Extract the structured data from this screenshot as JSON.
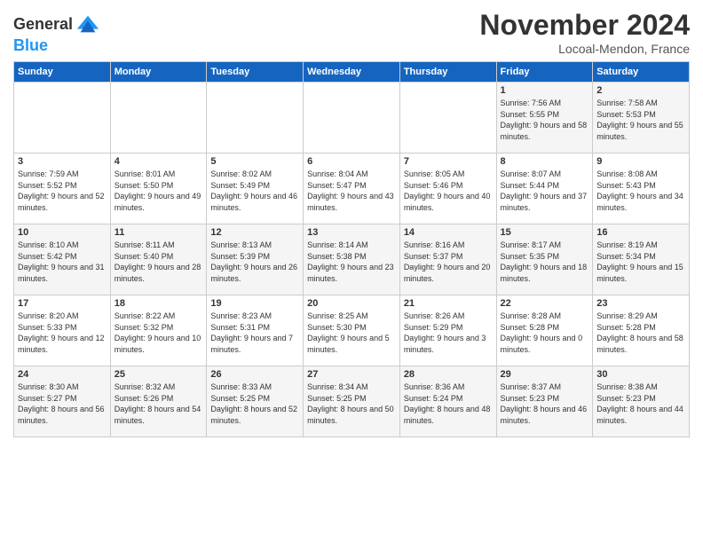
{
  "header": {
    "logo_line1": "General",
    "logo_line2": "Blue",
    "month_title": "November 2024",
    "location": "Locoal-Mendon, France"
  },
  "days_of_week": [
    "Sunday",
    "Monday",
    "Tuesday",
    "Wednesday",
    "Thursday",
    "Friday",
    "Saturday"
  ],
  "weeks": [
    [
      {
        "day": "",
        "info": ""
      },
      {
        "day": "",
        "info": ""
      },
      {
        "day": "",
        "info": ""
      },
      {
        "day": "",
        "info": ""
      },
      {
        "day": "",
        "info": ""
      },
      {
        "day": "1",
        "info": "Sunrise: 7:56 AM\nSunset: 5:55 PM\nDaylight: 9 hours and 58 minutes."
      },
      {
        "day": "2",
        "info": "Sunrise: 7:58 AM\nSunset: 5:53 PM\nDaylight: 9 hours and 55 minutes."
      }
    ],
    [
      {
        "day": "3",
        "info": "Sunrise: 7:59 AM\nSunset: 5:52 PM\nDaylight: 9 hours and 52 minutes."
      },
      {
        "day": "4",
        "info": "Sunrise: 8:01 AM\nSunset: 5:50 PM\nDaylight: 9 hours and 49 minutes."
      },
      {
        "day": "5",
        "info": "Sunrise: 8:02 AM\nSunset: 5:49 PM\nDaylight: 9 hours and 46 minutes."
      },
      {
        "day": "6",
        "info": "Sunrise: 8:04 AM\nSunset: 5:47 PM\nDaylight: 9 hours and 43 minutes."
      },
      {
        "day": "7",
        "info": "Sunrise: 8:05 AM\nSunset: 5:46 PM\nDaylight: 9 hours and 40 minutes."
      },
      {
        "day": "8",
        "info": "Sunrise: 8:07 AM\nSunset: 5:44 PM\nDaylight: 9 hours and 37 minutes."
      },
      {
        "day": "9",
        "info": "Sunrise: 8:08 AM\nSunset: 5:43 PM\nDaylight: 9 hours and 34 minutes."
      }
    ],
    [
      {
        "day": "10",
        "info": "Sunrise: 8:10 AM\nSunset: 5:42 PM\nDaylight: 9 hours and 31 minutes."
      },
      {
        "day": "11",
        "info": "Sunrise: 8:11 AM\nSunset: 5:40 PM\nDaylight: 9 hours and 28 minutes."
      },
      {
        "day": "12",
        "info": "Sunrise: 8:13 AM\nSunset: 5:39 PM\nDaylight: 9 hours and 26 minutes."
      },
      {
        "day": "13",
        "info": "Sunrise: 8:14 AM\nSunset: 5:38 PM\nDaylight: 9 hours and 23 minutes."
      },
      {
        "day": "14",
        "info": "Sunrise: 8:16 AM\nSunset: 5:37 PM\nDaylight: 9 hours and 20 minutes."
      },
      {
        "day": "15",
        "info": "Sunrise: 8:17 AM\nSunset: 5:35 PM\nDaylight: 9 hours and 18 minutes."
      },
      {
        "day": "16",
        "info": "Sunrise: 8:19 AM\nSunset: 5:34 PM\nDaylight: 9 hours and 15 minutes."
      }
    ],
    [
      {
        "day": "17",
        "info": "Sunrise: 8:20 AM\nSunset: 5:33 PM\nDaylight: 9 hours and 12 minutes."
      },
      {
        "day": "18",
        "info": "Sunrise: 8:22 AM\nSunset: 5:32 PM\nDaylight: 9 hours and 10 minutes."
      },
      {
        "day": "19",
        "info": "Sunrise: 8:23 AM\nSunset: 5:31 PM\nDaylight: 9 hours and 7 minutes."
      },
      {
        "day": "20",
        "info": "Sunrise: 8:25 AM\nSunset: 5:30 PM\nDaylight: 9 hours and 5 minutes."
      },
      {
        "day": "21",
        "info": "Sunrise: 8:26 AM\nSunset: 5:29 PM\nDaylight: 9 hours and 3 minutes."
      },
      {
        "day": "22",
        "info": "Sunrise: 8:28 AM\nSunset: 5:28 PM\nDaylight: 9 hours and 0 minutes."
      },
      {
        "day": "23",
        "info": "Sunrise: 8:29 AM\nSunset: 5:28 PM\nDaylight: 8 hours and 58 minutes."
      }
    ],
    [
      {
        "day": "24",
        "info": "Sunrise: 8:30 AM\nSunset: 5:27 PM\nDaylight: 8 hours and 56 minutes."
      },
      {
        "day": "25",
        "info": "Sunrise: 8:32 AM\nSunset: 5:26 PM\nDaylight: 8 hours and 54 minutes."
      },
      {
        "day": "26",
        "info": "Sunrise: 8:33 AM\nSunset: 5:25 PM\nDaylight: 8 hours and 52 minutes."
      },
      {
        "day": "27",
        "info": "Sunrise: 8:34 AM\nSunset: 5:25 PM\nDaylight: 8 hours and 50 minutes."
      },
      {
        "day": "28",
        "info": "Sunrise: 8:36 AM\nSunset: 5:24 PM\nDaylight: 8 hours and 48 minutes."
      },
      {
        "day": "29",
        "info": "Sunrise: 8:37 AM\nSunset: 5:23 PM\nDaylight: 8 hours and 46 minutes."
      },
      {
        "day": "30",
        "info": "Sunrise: 8:38 AM\nSunset: 5:23 PM\nDaylight: 8 hours and 44 minutes."
      }
    ]
  ]
}
